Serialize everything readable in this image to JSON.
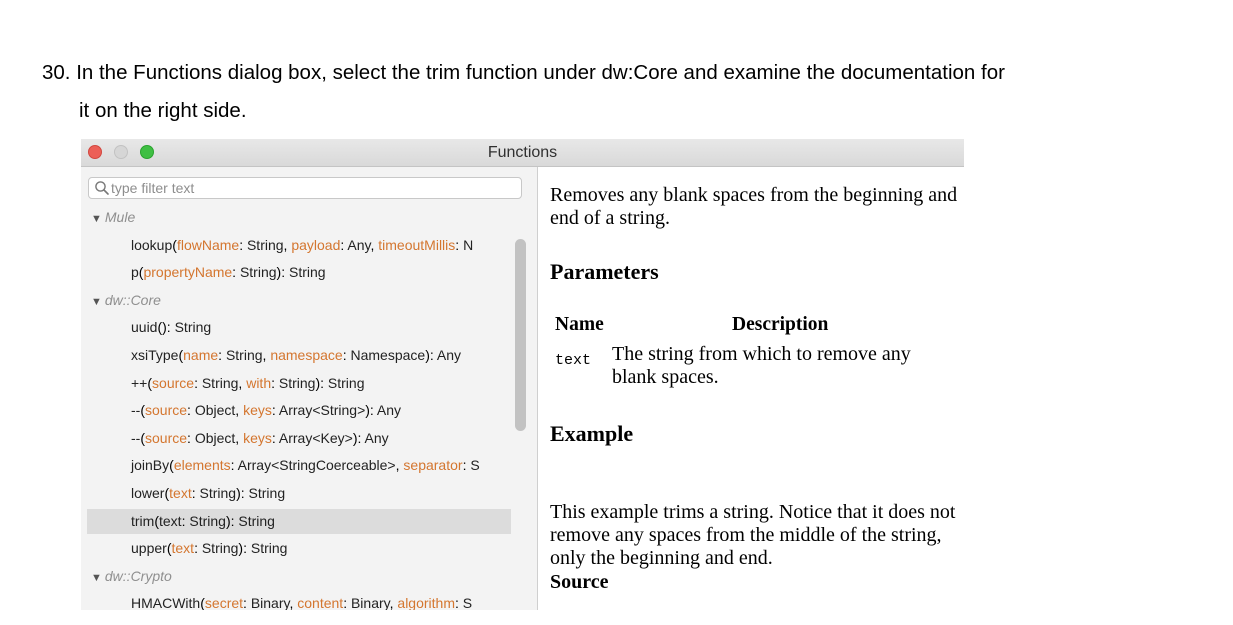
{
  "instruction": {
    "line1": "30. In the Functions dialog box, select the trim function under dw:Core and examine the documentation for",
    "line2": "it on the right side."
  },
  "window": {
    "title": "Functions",
    "controls": [
      "close",
      "minimize",
      "zoom"
    ]
  },
  "search": {
    "placeholder": "type filter text",
    "value": ""
  },
  "tree": {
    "groups": [
      {
        "label": "Mule",
        "functions": [
          {
            "name": "lookup",
            "params": [
              {
                "n": "flowName",
                "t": "String"
              },
              {
                "n": "payload",
                "t": "Any"
              },
              {
                "n": "timeoutMillis",
                "t": "N"
              }
            ],
            "ret": "",
            "truncated": true
          },
          {
            "name": "p",
            "params": [
              {
                "n": "propertyName",
                "t": "String"
              }
            ],
            "ret": "String"
          }
        ]
      },
      {
        "label": "dw::Core",
        "functions": [
          {
            "name": "uuid",
            "params": [],
            "ret": "String"
          },
          {
            "name": "xsiType",
            "params": [
              {
                "n": "name",
                "t": "String"
              },
              {
                "n": "namespace",
                "t": "Namespace"
              }
            ],
            "ret": "Any"
          },
          {
            "name": "++",
            "params": [
              {
                "n": "source",
                "t": "String"
              },
              {
                "n": "with",
                "t": "String"
              }
            ],
            "ret": "String"
          },
          {
            "name": "--",
            "params": [
              {
                "n": "source",
                "t": "Object"
              },
              {
                "n": "keys",
                "t": "Array<String>"
              }
            ],
            "ret": "Any"
          },
          {
            "name": "--",
            "params": [
              {
                "n": "source",
                "t": "Object"
              },
              {
                "n": "keys",
                "t": "Array<Key>"
              }
            ],
            "ret": "Any"
          },
          {
            "name": "joinBy",
            "params": [
              {
                "n": "elements",
                "t": "Array<StringCoerceable>"
              },
              {
                "n": "separator",
                "t": "S"
              }
            ],
            "ret": "",
            "truncated": true
          },
          {
            "name": "lower",
            "params": [
              {
                "n": "text",
                "t": "String"
              }
            ],
            "ret": "String"
          },
          {
            "name": "trim",
            "params": [
              {
                "n": "text",
                "t": "String"
              }
            ],
            "ret": "String",
            "selected": true
          },
          {
            "name": "upper",
            "params": [
              {
                "n": "text",
                "t": "String"
              }
            ],
            "ret": "String"
          }
        ]
      },
      {
        "label": "dw::Crypto",
        "functions": [
          {
            "name": "HMACWith",
            "params": [
              {
                "n": "secret",
                "t": "Binary"
              },
              {
                "n": "content",
                "t": "Binary"
              },
              {
                "n": "algorithm",
                "t": "S"
              }
            ],
            "ret": "",
            "truncated": true
          }
        ]
      }
    ]
  },
  "docs": {
    "description": "Removes any blank spaces from the beginning and end of a string.",
    "parameters_heading": "Parameters",
    "col_name": "Name",
    "col_description": "Description",
    "param_name": "text",
    "param_description": "The string from which to remove any blank spaces.",
    "example_heading": "Example",
    "example_text": "This example trims a string. Notice that it does not remove any spaces from the middle of the string, only the beginning and end.",
    "source_heading": "Source"
  },
  "colors": {
    "selected_row": "#dcdcdc",
    "param_name": "#d4762f",
    "close": "#ec5f57",
    "zoom": "#3fbf43"
  }
}
